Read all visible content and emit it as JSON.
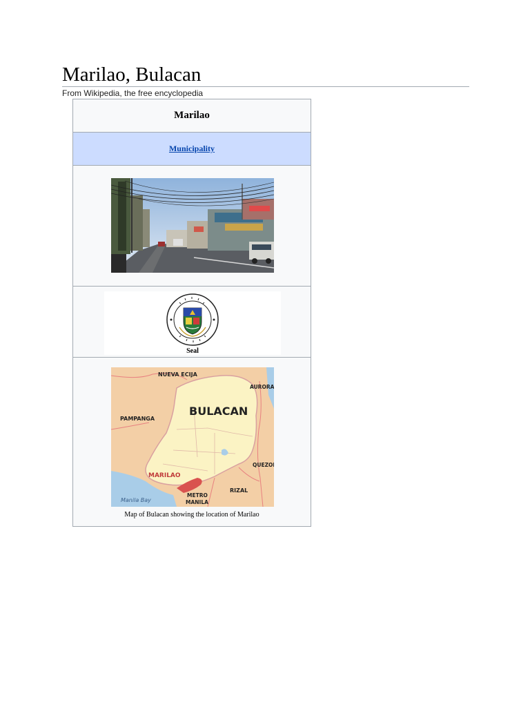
{
  "article": {
    "title": "Marilao, Bulacan",
    "tagline": "From Wikipedia, the free encyclopedia"
  },
  "infobox": {
    "name": "Marilao",
    "type_link": "Municipality",
    "seal": {
      "caption": "Seal",
      "ring_text_top": "BAYAN NG MARILAO",
      "ring_text_bottom": "LALAWIGAN NG BULACAN"
    },
    "map": {
      "caption": "Map of Bulacan showing the location of Marilao",
      "labels": {
        "nueva_ecija": "NUEVA ECIJA",
        "aurora": "AURORA",
        "bulacan": "BULACAN",
        "pampanga": "PAMPANGA",
        "quezon": "QUEZON",
        "marilao": "MARILAO",
        "rizal": "RIZAL",
        "metro_manila_1": "METRO",
        "metro_manila_2": "MANILA",
        "manila_bay": "Manila Bay"
      }
    }
  },
  "colors": {
    "link": "#0645ad",
    "header_band": "#ccdcff",
    "border": "#a2a9b1",
    "highlight_municipality": "#d9534f"
  }
}
